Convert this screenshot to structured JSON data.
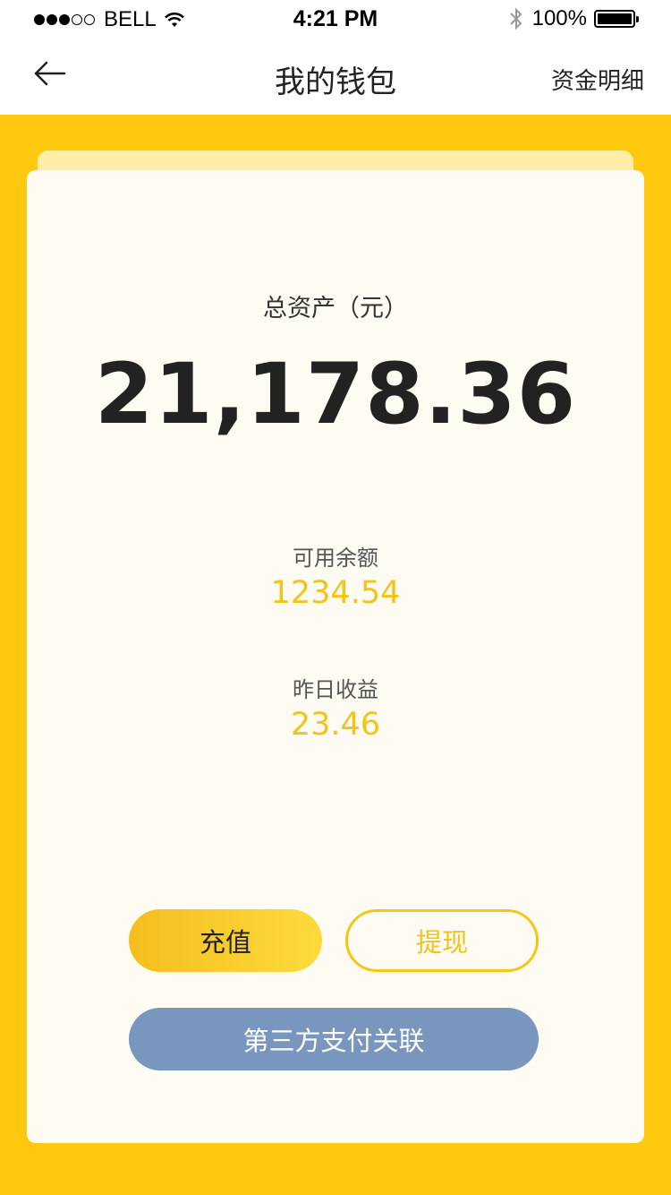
{
  "status_bar": {
    "carrier": "BELL",
    "time": "4:21 PM",
    "battery": "100%"
  },
  "nav": {
    "title": "我的钱包",
    "right_link": "资金明细"
  },
  "wallet": {
    "total_label": "总资产（元）",
    "total_value": "21,178.36",
    "available_label": "可用余额",
    "available_value": "1234.54",
    "yesterday_label": "昨日收益",
    "yesterday_value": "23.46"
  },
  "actions": {
    "recharge": "充值",
    "withdraw": "提现",
    "third_party": "第三方支付关联"
  },
  "colors": {
    "background": "#FEC90F",
    "accent": "#F5C21A",
    "third_party_button": "#7896BE"
  }
}
